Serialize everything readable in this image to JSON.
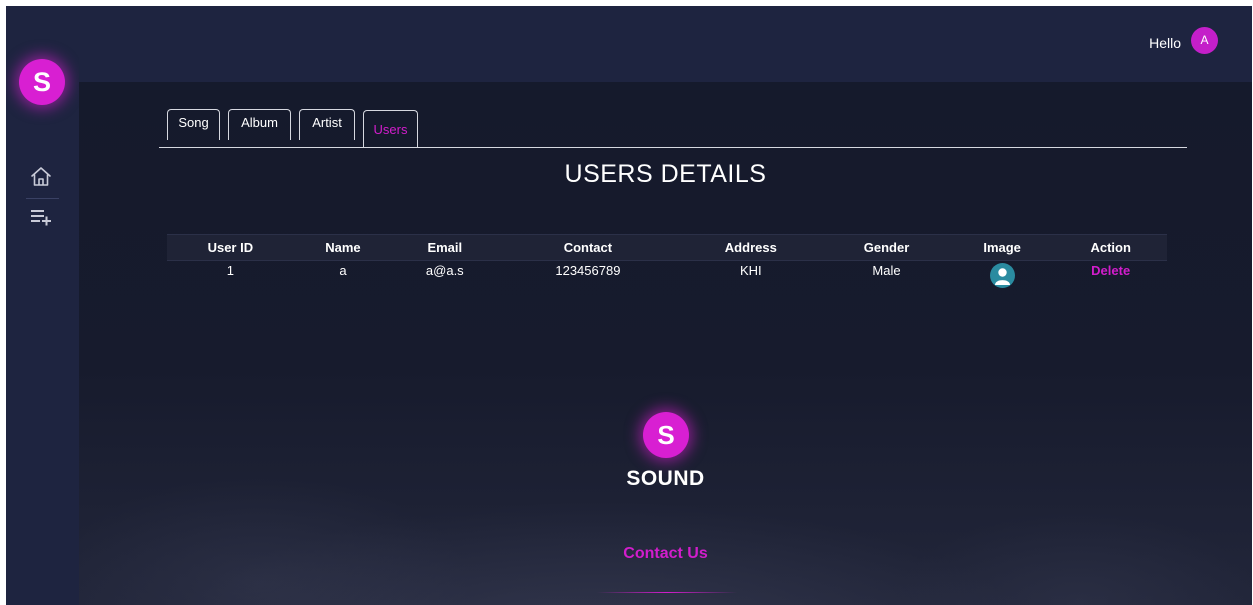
{
  "brand": {
    "logo_letter": "S",
    "name": "SOUND",
    "accent_color": "#d81fd2"
  },
  "header": {
    "greeting": "Hello",
    "avatar_initial": "A"
  },
  "sidebar": {
    "items": [
      {
        "icon": "home-icon"
      },
      {
        "icon": "playlist-add-icon"
      }
    ],
    "toggle_icon": "chevron-right-icon"
  },
  "tabs": [
    {
      "label": "Song",
      "active": false
    },
    {
      "label": "Album",
      "active": false
    },
    {
      "label": "Artist",
      "active": false
    },
    {
      "label": "Users",
      "active": true
    }
  ],
  "page_title": "USERS DETAILS",
  "table": {
    "headers": [
      "User ID",
      "Name",
      "Email",
      "Contact",
      "Address",
      "Gender",
      "Image",
      "Action"
    ],
    "rows": [
      {
        "user_id": "1",
        "name": "a",
        "email": "a@a.s",
        "contact": "123456789",
        "address": "KHI",
        "gender": "Male",
        "image_icon": "user-avatar-icon",
        "action": "Delete"
      }
    ]
  },
  "footer": {
    "logo_letter": "S",
    "brand": "SOUND",
    "contact_link": "Contact Us"
  }
}
